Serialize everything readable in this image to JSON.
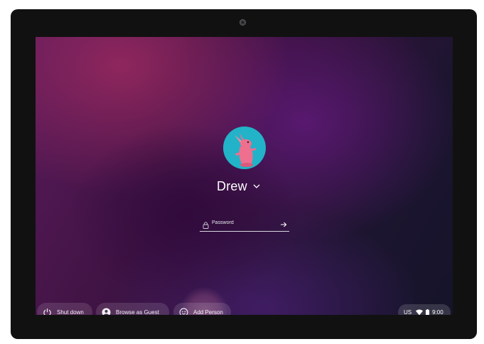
{
  "login": {
    "username": "Drew",
    "password_placeholder": "Password"
  },
  "shelf": {
    "shutdown_label": "Shut down",
    "guest_label": "Browse as Guest",
    "add_person_label": "Add Person"
  },
  "tray": {
    "ime": "US",
    "time": "9:00"
  },
  "icons": {
    "avatar": "pink-rabbit-avatar",
    "username_menu": "chevron-down-icon",
    "password": "lock-icon",
    "submit": "arrow-right-icon",
    "shutdown": "power-icon",
    "guest": "person-circle-icon",
    "add_person": "smiley-face-icon",
    "wifi": "wifi-icon",
    "battery": "battery-icon",
    "camera": "camera-icon"
  },
  "colors": {
    "avatar_background": "#22b3c8",
    "avatar_rabbit": "#ef6f8f"
  }
}
